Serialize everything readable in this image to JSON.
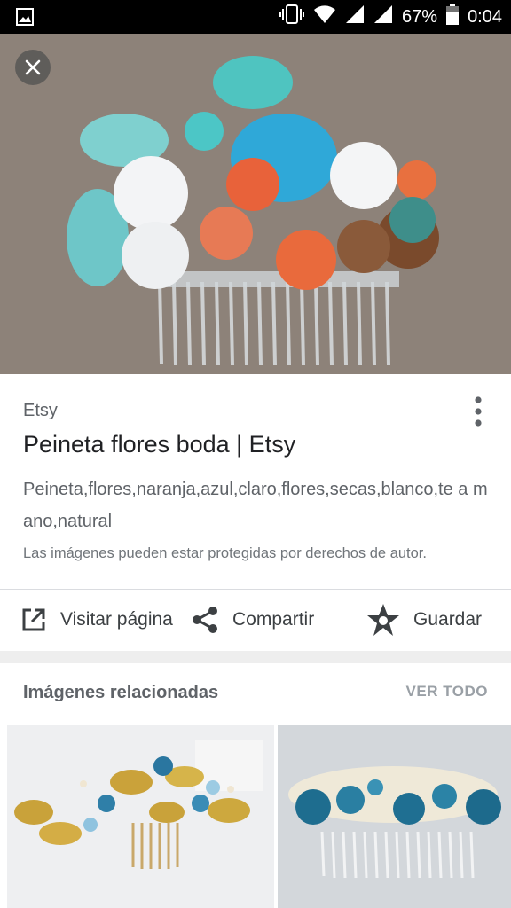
{
  "status_bar": {
    "battery_percent": "67%",
    "time": "0:04",
    "icons": [
      "image-icon",
      "vibrate-icon",
      "wifi-icon",
      "signal-icon",
      "signal-icon",
      "battery-icon"
    ]
  },
  "result": {
    "source": "Etsy",
    "title": "Peineta flores boda | Etsy",
    "description": "Peineta,flores,naranja,azul,claro,flores,secas,blanco,te a mano,natural",
    "copyright_notice": "Las imágenes pueden estar protegidas por derechos de autor."
  },
  "actions": [
    {
      "label": "Visitar página",
      "icon": "open-in-new-icon"
    },
    {
      "label": "Compartir",
      "icon": "share-icon"
    },
    {
      "label": "Guardar",
      "icon": "star-icon"
    }
  ],
  "related": {
    "title": "Imágenes relacionadas",
    "view_all": "VER TODO"
  },
  "colors": {
    "status_bar": "#000000",
    "card": "#ffffff",
    "background": "#eeeeee",
    "text_primary": "#202124",
    "text_secondary": "#5f6368"
  }
}
